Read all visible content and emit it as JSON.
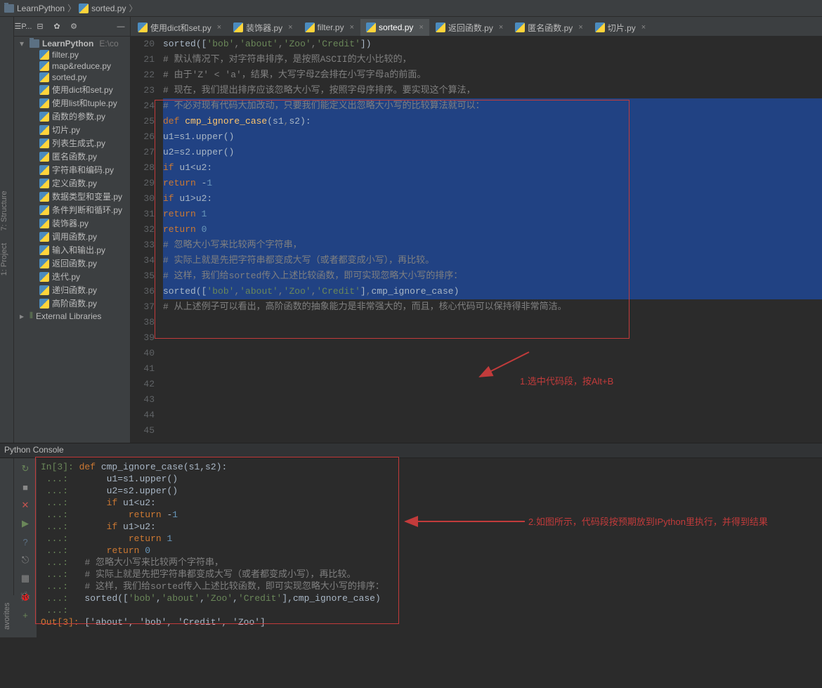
{
  "breadcrumb": {
    "root": "LearnPython",
    "file": "sorted.py"
  },
  "leftTabs": {
    "project": "1: Project",
    "structure": "7: Structure"
  },
  "sidebar": {
    "toolbar": [
      "P...",
      "⎙",
      "✿",
      "⚙"
    ],
    "root": {
      "name": "LearnPython",
      "extra": "E:\\co"
    },
    "files": [
      "filter.py",
      "map&reduce.py",
      "sorted.py",
      "使用dict和set.py",
      "使用list和tuple.py",
      "函数的参数.py",
      "切片.py",
      "列表生成式.py",
      "匿名函数.py",
      "字符串和编码.py",
      "定义函数.py",
      "数据类型和变量.py",
      "条件判断和循环.py",
      "装饰器.py",
      "调用函数.py",
      "输入和输出.py",
      "返回函数.py",
      "迭代.py",
      "递归函数.py",
      "高阶函数.py"
    ],
    "external": "External Libraries"
  },
  "tabs": [
    "使用dict和set.py",
    "装饰器.py",
    "filter.py",
    "sorted.py",
    "返回函数.py",
    "匿名函数.py",
    "切片.py"
  ],
  "activeTab": 3,
  "editor": {
    "startLine": 20,
    "lines": [
      {
        "sel": false,
        "html": "<span class='builtin'>sorted</span>([<span class='str'>'bob'</span><span class='cm'>,</span><span class='str'>'about'</span><span class='cm'>,</span><span class='str'>'Zoo'</span><span class='cm'>,</span><span class='str'>'Credit'</span>])"
      },
      {
        "sel": false,
        "html": "<span class='cm'># 默认情况下，对字符串排序，是按照ASCII的大小比较的，</span>"
      },
      {
        "sel": false,
        "html": "<span class='cm'># 由于'Z' < 'a'，结果，大写字母Z会排在小写字母a的前面。</span>"
      },
      {
        "sel": false,
        "html": "<span class='cm'># 现在，我们提出排序应该忽略大小写，按照字母序排序。要实现这个算法，</span>"
      },
      {
        "sel": true,
        "html": "<span class='cm'># 不必对现有代码大加改动，只要我们能定义出忽略大小写的比较算法就可以：</span>"
      },
      {
        "sel": true,
        "html": "<span class='kw'>def </span><span class='fn'>cmp_ignore_case</span>(s1<span class='cm'>,</span>s2):"
      },
      {
        "sel": true,
        "html": "    u1=s1.upper()"
      },
      {
        "sel": true,
        "html": "    u2=s2.upper()"
      },
      {
        "sel": true,
        "html": "    <span class='kw'>if</span> u1&lt;u2:"
      },
      {
        "sel": true,
        "html": "        <span class='kw'>return</span> -<span class='num'>1</span>"
      },
      {
        "sel": true,
        "html": "    <span class='kw'>if</span> u1&gt;u2:"
      },
      {
        "sel": true,
        "html": "        <span class='kw'>return</span> <span class='num'>1</span>"
      },
      {
        "sel": true,
        "html": "    <span class='kw'>return</span> <span class='num'>0</span>"
      },
      {
        "sel": true,
        "html": "<span class='cm'># 忽略大小写来比较两个字符串，</span>"
      },
      {
        "sel": true,
        "html": "<span class='cm'># 实际上就是先把字符串都变成大写（或者都变成小写），再比较。</span>"
      },
      {
        "sel": true,
        "html": "<span class='cm'># 这样，我们给sorted传入上述比较函数，即可实现忽略大小写的排序：</span>"
      },
      {
        "sel": true,
        "html": "<span class='builtin'>sorted</span>([<span class='str'>'bob'</span><span class='cm'>,</span><span class='str'>'about'</span><span class='cm'>,</span><span class='str'>'Zoo'</span><span class='cm'>,</span><span class='str'>'Credit'</span>]<span class='cm'>,</span>cmp_ignore_case)"
      },
      {
        "sel": false,
        "html": "<span class='cm'># 从上述例子可以看出，高阶函数的抽象能力是非常强大的，而且，核心代码可以保持得非常简洁。</span>"
      },
      {
        "sel": false,
        "html": ""
      },
      {
        "sel": false,
        "html": ""
      },
      {
        "sel": false,
        "html": ""
      },
      {
        "sel": false,
        "html": ""
      },
      {
        "sel": false,
        "html": ""
      },
      {
        "sel": false,
        "html": ""
      },
      {
        "sel": false,
        "html": ""
      },
      {
        "sel": false,
        "html": ""
      }
    ]
  },
  "annotation1": "1.选中代码段，按Alt+B",
  "annotation2": "2.如图所示，代码段按预期放到IPython里执行，并得到结果",
  "consoleLabel": "Python Console",
  "console": {
    "inLabel": "In[3]:",
    "dots": "...:",
    "outLabel": "Out[3]:",
    "lines": [
      "<span class='ckw'>def</span> cmp_ignore_case(s1,s2):",
      "    u1=s1.upper()",
      "    u2=s2.upper()",
      "    <span class='ckw'>if</span> u1&lt;u2:",
      "        <span class='ckw'>return</span> -<span class='cnum'>1</span>",
      "    <span class='ckw'>if</span> u1&gt;u2:",
      "        <span class='ckw'>return</span> <span class='cnum'>1</span>",
      "    <span class='ckw'>return</span> <span class='cnum'>0</span>",
      "<span class='ccm'># 忽略大小写来比较两个字符串，</span>",
      "<span class='ccm'># 实际上就是先把字符串都变成大写（或者都变成小写），再比较。</span>",
      "<span class='ccm'># 这样，我们给sorted传入上述比较函数，即可实现忽略大小写的排序：</span>",
      "sorted([<span class='cstr'>'bob'</span>,<span class='cstr'>'about'</span>,<span class='cstr'>'Zoo'</span>,<span class='cstr'>'Credit'</span>],cmp_ignore_case)"
    ],
    "output": "['about', 'bob', 'Credit', 'Zoo']"
  },
  "favorites": "avorites"
}
